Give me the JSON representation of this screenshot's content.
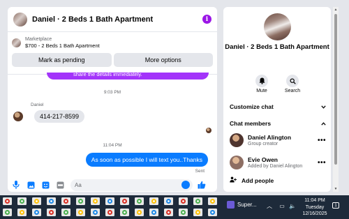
{
  "header": {
    "title": "Daniel · 2 Beds 1 Bath Apartment",
    "info_icon": "i"
  },
  "marketplace": {
    "label": "Marketplace",
    "item": "$700 - 2 Beds 1 Bath Apartment",
    "buttons": [
      "Mark as pending",
      "More options"
    ]
  },
  "messages": {
    "cut_text": "share the details immediately.",
    "time1": "9:03 PM",
    "sender": "Daniel",
    "incoming": "414-217-8599",
    "time2": "11:04 PM",
    "outgoing": "As soon as possible I will text you..Thanks",
    "status": "Sent"
  },
  "composer": {
    "placeholder": "Aa"
  },
  "side": {
    "title": "Daniel · 2 Beds 1 Bath Apartment",
    "actions": [
      {
        "label": "Mute",
        "icon": "bell-icon"
      },
      {
        "label": "Search",
        "icon": "search-icon"
      }
    ],
    "customize": "Customize chat",
    "members_header": "Chat members",
    "members": [
      {
        "name": "Daniel Alington",
        "sub": "Group creator"
      },
      {
        "name": "Evie Owen",
        "sub": "Added by Daniel Alington"
      }
    ],
    "add_people": "Add people"
  },
  "taskbar": {
    "app": "Super...",
    "time": "11:04 PM",
    "day": "Tuesday",
    "date": "12/16/2025",
    "notification_count": "1"
  },
  "colors": {
    "accent": "#0a7cff",
    "purple": "#a334fa",
    "taskbar": "#1d2a3a"
  }
}
